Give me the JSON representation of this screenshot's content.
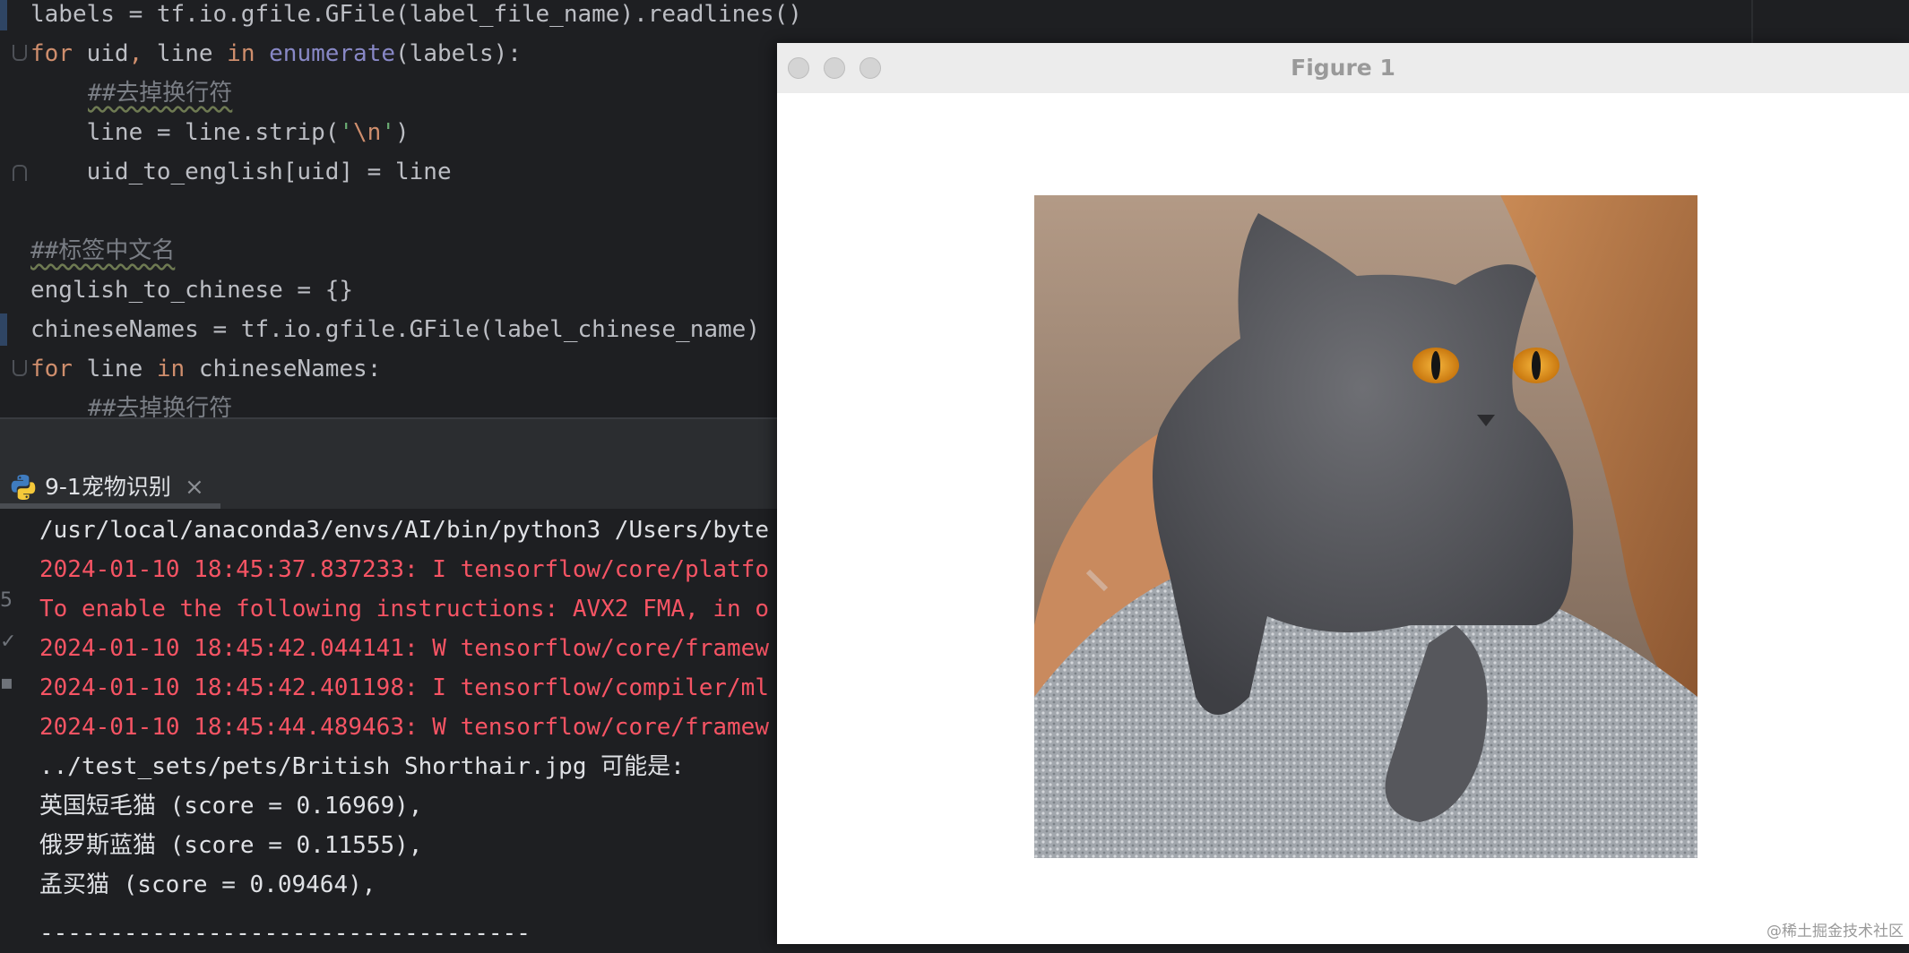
{
  "editor": {
    "lines": [
      {
        "id": "l1",
        "t": "labels = tf.io.gfile.GFile(label_file_name).readlines()"
      },
      {
        "id": "l2a",
        "t": "for"
      },
      {
        "id": "l2b",
        "t": " uid"
      },
      {
        "id": "l2c",
        "t": ","
      },
      {
        "id": "l2d",
        "t": " line "
      },
      {
        "id": "l2e",
        "t": "in"
      },
      {
        "id": "l2f",
        "t": " "
      },
      {
        "id": "l2g",
        "t": "enumerate"
      },
      {
        "id": "l2h",
        "t": "(labels):"
      }
    ],
    "line1": "labels = tf.io.gfile.GFile(label_file_name).readlines()",
    "line2_kw_for": "for",
    "line2_mid": " uid",
    "line2_comma": ",",
    "line2_line": " line ",
    "line2_kw_in": "in",
    "line2_builtin": "enumerate",
    "line2_end": "(labels):",
    "line3_comment": "##去掉换行符",
    "line4_start": "    line = line.strip(",
    "line4_q1": "'",
    "line4_esc": "\\n",
    "line4_q2": "'",
    "line4_end": ")",
    "line5": "    uid_to_english[uid] = line",
    "line7_comment": "##标签中文名",
    "line8": "english_to_chinese = {}",
    "line9": "chineseNames = tf.io.gfile.GFile(label_chinese_name)",
    "line10_kw_for": "for",
    "line10_mid": " line ",
    "line10_kw_in": "in",
    "line10_end": " chineseNames:",
    "line11_comment": "##去掉换行符"
  },
  "run_panel": {
    "tab_label": "9-1宠物识别",
    "tab_close": "×",
    "console": [
      "/usr/local/anaconda3/envs/AI/bin/python3 /Users/byte",
      "2024-01-10 18:45:37.837233: I tensorflow/core/platfo",
      "To enable the following instructions: AVX2 FMA, in o",
      "2024-01-10 18:45:42.044141: W tensorflow/core/framew",
      "2024-01-10 18:45:42.401198: I tensorflow/compiler/ml",
      "2024-01-10 18:45:44.489463: W tensorflow/core/framew",
      "../test_sets/pets/British Shorthair.jpg 可能是:",
      "英国短毛猫 (score = 0.16969),",
      "俄罗斯蓝猫 (score = 0.11555),",
      "孟买猫 (score = 0.09464),",
      "-----------------------------------"
    ]
  },
  "figure": {
    "title": "Figure 1"
  },
  "watermark": "@稀土掘金技术社区",
  "colors": {
    "editor_bg": "#1e1f22",
    "keyword": "#cf8e6d",
    "builtin": "#8888c6",
    "string": "#6aab73",
    "comment": "#7a7e85",
    "error_text": "#f75464",
    "console_text": "#dfe1e5"
  }
}
